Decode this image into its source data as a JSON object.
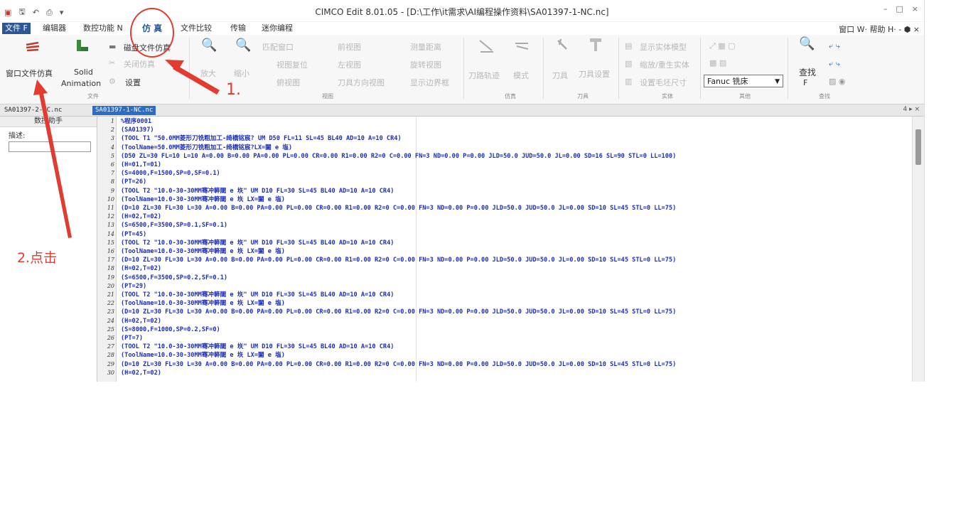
{
  "app": {
    "title": "CIMCO Edit 8.01.05 - [D:\\工作\\it需求\\AI编程操作资料\\SA01397-1-NC.nc]",
    "window_controls": [
      "–",
      "□",
      "×"
    ]
  },
  "menu": {
    "tabs": [
      "文件 F",
      "编辑器",
      "数控功能 N",
      "仿 真",
      "文件比较",
      "传输",
      "迷你编程"
    ],
    "right": "窗口 W· 帮助 H· - ⬢ ×"
  },
  "ribbon": {
    "file_group": {
      "window_sim": "窗口文件仿真",
      "solid": "Solid",
      "animation": "Animation",
      "disk_sim": "磁盘文件仿真",
      "close_file": "关闭仿真",
      "settings": "设置",
      "label": "文件"
    },
    "view_group": {
      "zoom_in": "放大",
      "zoom_out": "缩小",
      "fit_window": "匹配窗口",
      "front_view": "前视图",
      "measure": "测量距离",
      "reset_view": "视图复位",
      "left_view": "左视图",
      "rotate_view": "旋转视图",
      "top_view": "俯视图",
      "tool_dir_view": "刀具方向视图",
      "show_bbox": "显示边界框",
      "label": "视图"
    },
    "sim_group": {
      "toolpath": "刀路轨迹",
      "mode": "模式",
      "label": "仿真"
    },
    "tool_group": {
      "tool": "刀具",
      "tool_settings": "刀具设置",
      "label": "刀具"
    },
    "solid_group": {
      "show_solid": "显示实体模型",
      "regen_solid": "缩放/重生实体",
      "stock_size": "设置毛坯尺寸",
      "label": "实体"
    },
    "other_group": {
      "machine": "Fanuc 铣床",
      "label": "其他"
    },
    "find_group": {
      "find": "查找",
      "find_key": "F",
      "label": "查找"
    }
  },
  "doc_tabs": [
    "SA01397-2-NC.nc",
    "SA01397-1-NC.nc"
  ],
  "doc_tabs_right": "4 ▸ ×",
  "left_panel": {
    "title": "数控助手",
    "desc_label": "描述:"
  },
  "editor": {
    "lines": [
      "%程序0001",
      "(SA01397)",
      "(TOOL T1 \"50.0MM菱形刀铣粗加工-绮橋铭宸? UM D50 FL=11 SL=45 BL40 AD=10 A=10 CR4)",
      "(ToolName=50.0MM菱形刀铣粗加工-绮橋铭宸?LX=闔 e 塩)",
      "(D50 ZL=30 FL=10 L=10 A=0.00 B=0.00 PA=0.00 PL=0.00 CR=0.00 R1=0.00 R2=0 C=0.00 FN=3 ND=0.00 P=0.00 JLD=50.0 JUD=50.0 JL=0.00 SD=16 SL=90 STL=0 LL=100)",
      "(H=01,T=01)",
      "(S=4000,F=1500,SP=0,SF=0.1)",
      "(PT=26)",
      "(TOOL T2 \"10.0-30-30MM骞冲簳閾 e 垁\" UM D10 FL=30 SL=45 BL40 AD=10 A=10 CR4)",
      "(ToolName=10.0-30-30MM骞冲簳閾 e 垁 LX=闔 e 塩)",
      "(D=10 ZL=30 FL=30 L=30 A=0.00 B=0.00 PA=0.00 PL=0.00 CR=0.00 R1=0.00 R2=0 C=0.00 FN=3 ND=0.00 P=0.00 JLD=50.0 JUD=50.0 JL=0.00 SD=10 SL=45 STL=0 LL=75)",
      "(H=02,T=02)",
      "(S=6500,F=3500,SP=0.1,SF=0.1)",
      "(PT=45)",
      "(TOOL T2 \"10.0-30-30MM骞冲簳閾 e 垁\" UM D10 FL=30 SL=45 BL40 AD=10 A=10 CR4)",
      "(ToolName=10.0-30-30MM骞冲簳閾 e 垁 LX=闔 e 塩)",
      "(D=10 ZL=30 FL=30 L=30 A=0.00 B=0.00 PA=0.00 PL=0.00 CR=0.00 R1=0.00 R2=0 C=0.00 FN=3 ND=0.00 P=0.00 JLD=50.0 JUD=50.0 JL=0.00 SD=10 SL=45 STL=0 LL=75)",
      "(H=02,T=02)",
      "(S=6500,F=3500,SP=0.2,SF=0.1)",
      "(PT=29)",
      "(TOOL T2 \"10.0-30-30MM骞冲簳閾 e 垁\" UM D10 FL=30 SL=45 BL40 AD=10 A=10 CR4)",
      "(ToolName=10.0-30-30MM骞冲簳閾 e 垁 LX=闔 e 塩)",
      "(D=10 ZL=30 FL=30 L=30 A=0.00 B=0.00 PA=0.00 PL=0.00 CR=0.00 R1=0.00 R2=0 C=0.00 FN=3 ND=0.00 P=0.00 JLD=50.0 JUD=50.0 JL=0.00 SD=10 SL=45 STL=0 LL=75)",
      "(H=02,T=02)",
      "(S=8000,F=1000,SP=0.2,SF=0)",
      "(PT=7)",
      "(TOOL T2 \"10.0-30-30MM骞冲簳閾 e 垁\" UM D10 FL=30 SL=45 BL40 AD=10 A=10 CR4)",
      "(ToolName=10.0-30-30MM骞冲簳閾 e 垁 LX=闔 e 塩)",
      "(D=10 ZL=30 FL=30 L=30 A=0.00 B=0.00 PA=0.00 PL=0.00 CR=0.00 R1=0.00 R2=0 C=0.00 FN=3 ND=0.00 P=0.00 JLD=50.0 JUD=50.0 JL=0.00 SD=10 SL=45 STL=0 LL=75)",
      "(H=02,T=02)"
    ]
  },
  "annotations": {
    "step1": "1.",
    "step2": "2.点击"
  },
  "colors": {
    "annotation": "#e23b2f",
    "code": "#1c2fb8",
    "accent": "#2b5797"
  }
}
